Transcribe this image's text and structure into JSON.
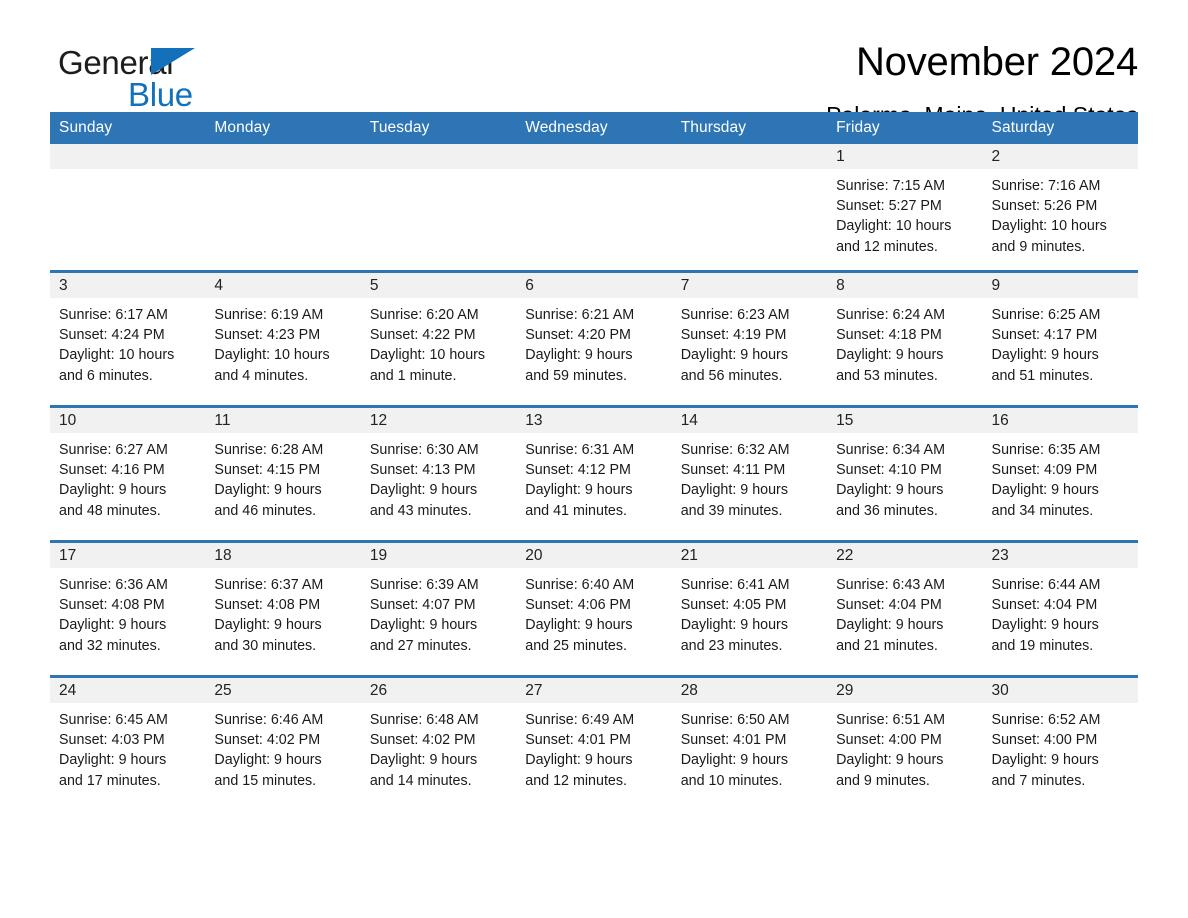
{
  "brand": {
    "name_part1": "General",
    "name_part2": "Blue",
    "accent_color": "#1271ba"
  },
  "header": {
    "title": "November 2024",
    "subtitle": "Palermo, Maine, United States",
    "header_bg_color": "#2e75b6",
    "daynum_bg_color": "#f1f1f1"
  },
  "weekdays": [
    "Sunday",
    "Monday",
    "Tuesday",
    "Wednesday",
    "Thursday",
    "Friday",
    "Saturday"
  ],
  "weeks": [
    [
      {
        "day": "",
        "sunrise": "",
        "sunset": "",
        "daylight1": "",
        "daylight2": ""
      },
      {
        "day": "",
        "sunrise": "",
        "sunset": "",
        "daylight1": "",
        "daylight2": ""
      },
      {
        "day": "",
        "sunrise": "",
        "sunset": "",
        "daylight1": "",
        "daylight2": ""
      },
      {
        "day": "",
        "sunrise": "",
        "sunset": "",
        "daylight1": "",
        "daylight2": ""
      },
      {
        "day": "",
        "sunrise": "",
        "sunset": "",
        "daylight1": "",
        "daylight2": ""
      },
      {
        "day": "1",
        "sunrise": "Sunrise: 7:15 AM",
        "sunset": "Sunset: 5:27 PM",
        "daylight1": "Daylight: 10 hours",
        "daylight2": "and 12 minutes."
      },
      {
        "day": "2",
        "sunrise": "Sunrise: 7:16 AM",
        "sunset": "Sunset: 5:26 PM",
        "daylight1": "Daylight: 10 hours",
        "daylight2": "and 9 minutes."
      }
    ],
    [
      {
        "day": "3",
        "sunrise": "Sunrise: 6:17 AM",
        "sunset": "Sunset: 4:24 PM",
        "daylight1": "Daylight: 10 hours",
        "daylight2": "and 6 minutes."
      },
      {
        "day": "4",
        "sunrise": "Sunrise: 6:19 AM",
        "sunset": "Sunset: 4:23 PM",
        "daylight1": "Daylight: 10 hours",
        "daylight2": "and 4 minutes."
      },
      {
        "day": "5",
        "sunrise": "Sunrise: 6:20 AM",
        "sunset": "Sunset: 4:22 PM",
        "daylight1": "Daylight: 10 hours",
        "daylight2": "and 1 minute."
      },
      {
        "day": "6",
        "sunrise": "Sunrise: 6:21 AM",
        "sunset": "Sunset: 4:20 PM",
        "daylight1": "Daylight: 9 hours",
        "daylight2": "and 59 minutes."
      },
      {
        "day": "7",
        "sunrise": "Sunrise: 6:23 AM",
        "sunset": "Sunset: 4:19 PM",
        "daylight1": "Daylight: 9 hours",
        "daylight2": "and 56 minutes."
      },
      {
        "day": "8",
        "sunrise": "Sunrise: 6:24 AM",
        "sunset": "Sunset: 4:18 PM",
        "daylight1": "Daylight: 9 hours",
        "daylight2": "and 53 minutes."
      },
      {
        "day": "9",
        "sunrise": "Sunrise: 6:25 AM",
        "sunset": "Sunset: 4:17 PM",
        "daylight1": "Daylight: 9 hours",
        "daylight2": "and 51 minutes."
      }
    ],
    [
      {
        "day": "10",
        "sunrise": "Sunrise: 6:27 AM",
        "sunset": "Sunset: 4:16 PM",
        "daylight1": "Daylight: 9 hours",
        "daylight2": "and 48 minutes."
      },
      {
        "day": "11",
        "sunrise": "Sunrise: 6:28 AM",
        "sunset": "Sunset: 4:15 PM",
        "daylight1": "Daylight: 9 hours",
        "daylight2": "and 46 minutes."
      },
      {
        "day": "12",
        "sunrise": "Sunrise: 6:30 AM",
        "sunset": "Sunset: 4:13 PM",
        "daylight1": "Daylight: 9 hours",
        "daylight2": "and 43 minutes."
      },
      {
        "day": "13",
        "sunrise": "Sunrise: 6:31 AM",
        "sunset": "Sunset: 4:12 PM",
        "daylight1": "Daylight: 9 hours",
        "daylight2": "and 41 minutes."
      },
      {
        "day": "14",
        "sunrise": "Sunrise: 6:32 AM",
        "sunset": "Sunset: 4:11 PM",
        "daylight1": "Daylight: 9 hours",
        "daylight2": "and 39 minutes."
      },
      {
        "day": "15",
        "sunrise": "Sunrise: 6:34 AM",
        "sunset": "Sunset: 4:10 PM",
        "daylight1": "Daylight: 9 hours",
        "daylight2": "and 36 minutes."
      },
      {
        "day": "16",
        "sunrise": "Sunrise: 6:35 AM",
        "sunset": "Sunset: 4:09 PM",
        "daylight1": "Daylight: 9 hours",
        "daylight2": "and 34 minutes."
      }
    ],
    [
      {
        "day": "17",
        "sunrise": "Sunrise: 6:36 AM",
        "sunset": "Sunset: 4:08 PM",
        "daylight1": "Daylight: 9 hours",
        "daylight2": "and 32 minutes."
      },
      {
        "day": "18",
        "sunrise": "Sunrise: 6:37 AM",
        "sunset": "Sunset: 4:08 PM",
        "daylight1": "Daylight: 9 hours",
        "daylight2": "and 30 minutes."
      },
      {
        "day": "19",
        "sunrise": "Sunrise: 6:39 AM",
        "sunset": "Sunset: 4:07 PM",
        "daylight1": "Daylight: 9 hours",
        "daylight2": "and 27 minutes."
      },
      {
        "day": "20",
        "sunrise": "Sunrise: 6:40 AM",
        "sunset": "Sunset: 4:06 PM",
        "daylight1": "Daylight: 9 hours",
        "daylight2": "and 25 minutes."
      },
      {
        "day": "21",
        "sunrise": "Sunrise: 6:41 AM",
        "sunset": "Sunset: 4:05 PM",
        "daylight1": "Daylight: 9 hours",
        "daylight2": "and 23 minutes."
      },
      {
        "day": "22",
        "sunrise": "Sunrise: 6:43 AM",
        "sunset": "Sunset: 4:04 PM",
        "daylight1": "Daylight: 9 hours",
        "daylight2": "and 21 minutes."
      },
      {
        "day": "23",
        "sunrise": "Sunrise: 6:44 AM",
        "sunset": "Sunset: 4:04 PM",
        "daylight1": "Daylight: 9 hours",
        "daylight2": "and 19 minutes."
      }
    ],
    [
      {
        "day": "24",
        "sunrise": "Sunrise: 6:45 AM",
        "sunset": "Sunset: 4:03 PM",
        "daylight1": "Daylight: 9 hours",
        "daylight2": "and 17 minutes."
      },
      {
        "day": "25",
        "sunrise": "Sunrise: 6:46 AM",
        "sunset": "Sunset: 4:02 PM",
        "daylight1": "Daylight: 9 hours",
        "daylight2": "and 15 minutes."
      },
      {
        "day": "26",
        "sunrise": "Sunrise: 6:48 AM",
        "sunset": "Sunset: 4:02 PM",
        "daylight1": "Daylight: 9 hours",
        "daylight2": "and 14 minutes."
      },
      {
        "day": "27",
        "sunrise": "Sunrise: 6:49 AM",
        "sunset": "Sunset: 4:01 PM",
        "daylight1": "Daylight: 9 hours",
        "daylight2": "and 12 minutes."
      },
      {
        "day": "28",
        "sunrise": "Sunrise: 6:50 AM",
        "sunset": "Sunset: 4:01 PM",
        "daylight1": "Daylight: 9 hours",
        "daylight2": "and 10 minutes."
      },
      {
        "day": "29",
        "sunrise": "Sunrise: 6:51 AM",
        "sunset": "Sunset: 4:00 PM",
        "daylight1": "Daylight: 9 hours",
        "daylight2": "and 9 minutes."
      },
      {
        "day": "30",
        "sunrise": "Sunrise: 6:52 AM",
        "sunset": "Sunset: 4:00 PM",
        "daylight1": "Daylight: 9 hours",
        "daylight2": "and 7 minutes."
      }
    ]
  ]
}
